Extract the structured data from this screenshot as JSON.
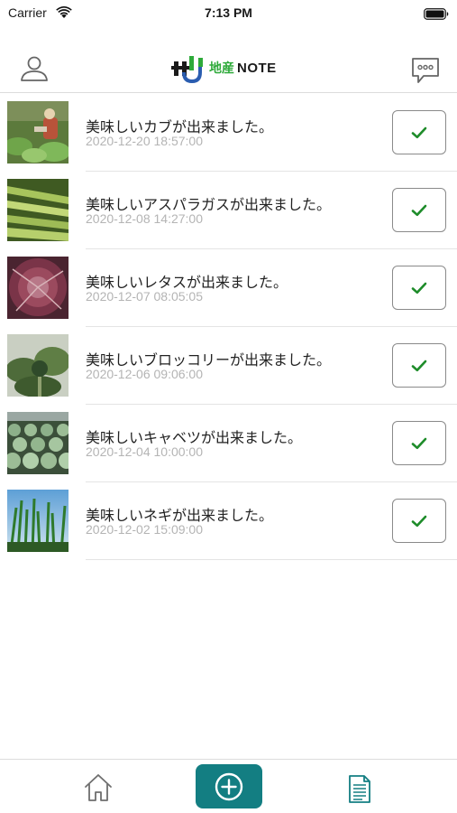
{
  "status_bar": {
    "carrier": "Carrier",
    "time": "7:13 PM",
    "wifi_icon": "wifi-icon",
    "battery_icon": "battery-icon"
  },
  "header": {
    "logo_kanji": "地産",
    "logo_text": "NOTE",
    "left_icon": "person-icon",
    "right_icon": "chat-bubble-icon"
  },
  "posts": [
    {
      "title": "美味しいカブが出来ました。",
      "datetime": "2020-12-20 18:57:00",
      "thumbnail": "farmer-harvesting-turnips-photo"
    },
    {
      "title": "美味しいアスパラガスが出来ました。",
      "datetime": "2020-12-08 14:27:00",
      "thumbnail": "asparagus-photo"
    },
    {
      "title": "美味しいレタスが出来ました。",
      "datetime": "2020-12-07 08:05:05",
      "thumbnail": "red-lettuce-photo"
    },
    {
      "title": "美味しいブロッコリーが出来ました。",
      "datetime": "2020-12-06 09:06:00",
      "thumbnail": "broccoli-plant-photo"
    },
    {
      "title": "美味しいキャベツが出来ました。",
      "datetime": "2020-12-04 10:00:00",
      "thumbnail": "cabbage-field-photo"
    },
    {
      "title": "美味しいネギが出来ました。",
      "datetime": "2020-12-02 15:09:00",
      "thumbnail": "green-onion-photo"
    }
  ],
  "tab_bar": {
    "home_icon": "home-icon",
    "add_icon": "plus-circle-icon",
    "notes_icon": "document-list-icon"
  },
  "colors": {
    "accent": "#137e82",
    "check": "#1e8c2a",
    "logo_green": "#2eaa3a",
    "date_text": "#b4b4b4"
  }
}
